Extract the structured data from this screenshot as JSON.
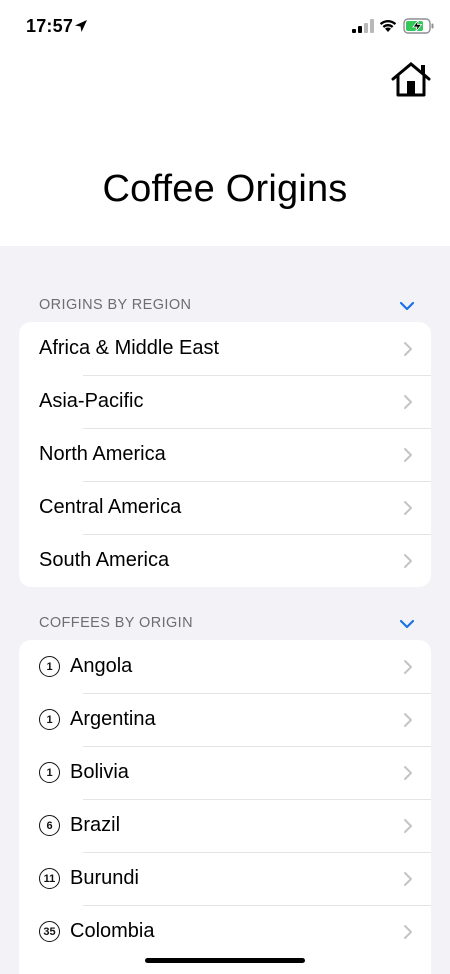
{
  "status_bar": {
    "time": "17:57"
  },
  "page_title": "Coffee Origins",
  "sections": {
    "regions": {
      "header": "ORIGINS BY REGION",
      "items": [
        {
          "label": "Africa & Middle East"
        },
        {
          "label": "Asia-Pacific"
        },
        {
          "label": "North America"
        },
        {
          "label": "Central America"
        },
        {
          "label": "South America"
        }
      ]
    },
    "coffees": {
      "header": "COFFEES BY ORIGIN",
      "items": [
        {
          "count": "1",
          "label": "Angola"
        },
        {
          "count": "1",
          "label": "Argentina"
        },
        {
          "count": "1",
          "label": "Bolivia"
        },
        {
          "count": "6",
          "label": "Brazil"
        },
        {
          "count": "11",
          "label": "Burundi"
        },
        {
          "count": "35",
          "label": "Colombia"
        }
      ]
    }
  },
  "colors": {
    "accent": "#1a73e8",
    "grouped_background": "#f2f2f7",
    "section_header_text": "#6d6d72",
    "disclosure": "#c4c4c7"
  },
  "icons": {
    "home": "home-icon",
    "location": "location-arrow-icon",
    "signal": "cellular-signal-icon",
    "wifi": "wifi-icon",
    "battery": "battery-charging-icon",
    "collapse": "chevron-down-icon",
    "disclosure": "chevron-right-icon"
  }
}
